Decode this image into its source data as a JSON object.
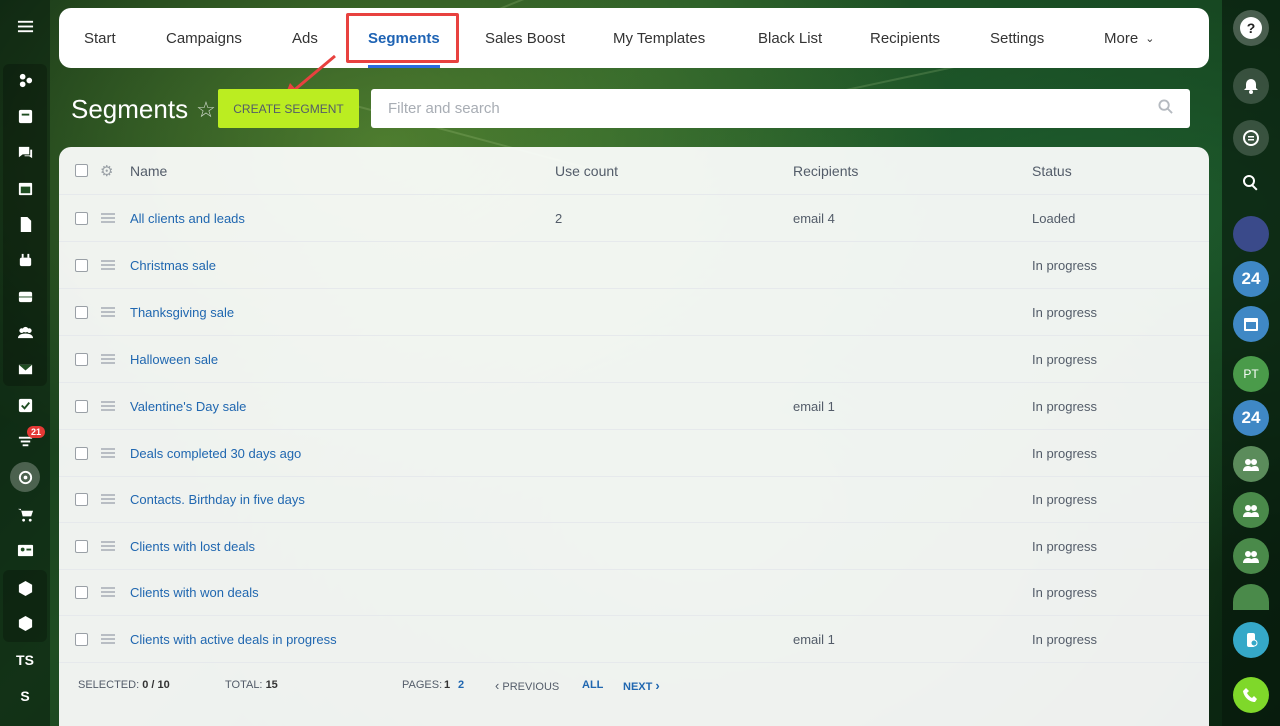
{
  "nav": {
    "tabs": [
      "Start",
      "Campaigns",
      "Ads",
      "Segments",
      "Sales Boost",
      "My Templates",
      "Black List",
      "Recipients",
      "Settings",
      "More"
    ],
    "active": "Segments"
  },
  "page": {
    "title": "Segments",
    "create_button": "CREATE SEGMENT",
    "search_placeholder": "Filter and search"
  },
  "table": {
    "columns": [
      "Name",
      "Use count",
      "Recipients",
      "Status"
    ],
    "rows": [
      {
        "name": "All clients and leads",
        "use_count": "2",
        "recipients": "email 4",
        "status": "Loaded"
      },
      {
        "name": "Christmas sale",
        "use_count": "",
        "recipients": "",
        "status": "In progress"
      },
      {
        "name": "Thanksgiving sale",
        "use_count": "",
        "recipients": "",
        "status": "In progress"
      },
      {
        "name": "Halloween sale",
        "use_count": "",
        "recipients": "",
        "status": "In progress"
      },
      {
        "name": "Valentine's Day sale",
        "use_count": "",
        "recipients": "email 1",
        "status": "In progress"
      },
      {
        "name": "Deals completed 30 days ago",
        "use_count": "",
        "recipients": "",
        "status": "In progress"
      },
      {
        "name": "Contacts. Birthday in five days",
        "use_count": "",
        "recipients": "",
        "status": "In progress"
      },
      {
        "name": "Clients with lost deals",
        "use_count": "",
        "recipients": "",
        "status": "In progress"
      },
      {
        "name": "Clients with won deals",
        "use_count": "",
        "recipients": "",
        "status": "In progress"
      },
      {
        "name": "Clients with active deals in progress",
        "use_count": "",
        "recipients": "email 1",
        "status": "In progress"
      }
    ]
  },
  "footer": {
    "selected_label": "SELECTED:",
    "selected_value": "0 / 10",
    "total_label": "TOTAL:",
    "total_value": "15",
    "pages_label": "PAGES:",
    "page_1": "1",
    "page_2": "2",
    "previous": "PREVIOUS",
    "all": "ALL",
    "next": "NEXT"
  },
  "left_sidebar": {
    "badge_count": "21",
    "initials": "TS",
    "last": "S"
  },
  "right_sidebar": {
    "help": "?",
    "app24": "24",
    "user_initials": "PT"
  },
  "colors": {
    "accent": "#bbed21",
    "link": "#2067b0",
    "highlight": "#e8413f",
    "active_tab": "#2a6ae0"
  }
}
